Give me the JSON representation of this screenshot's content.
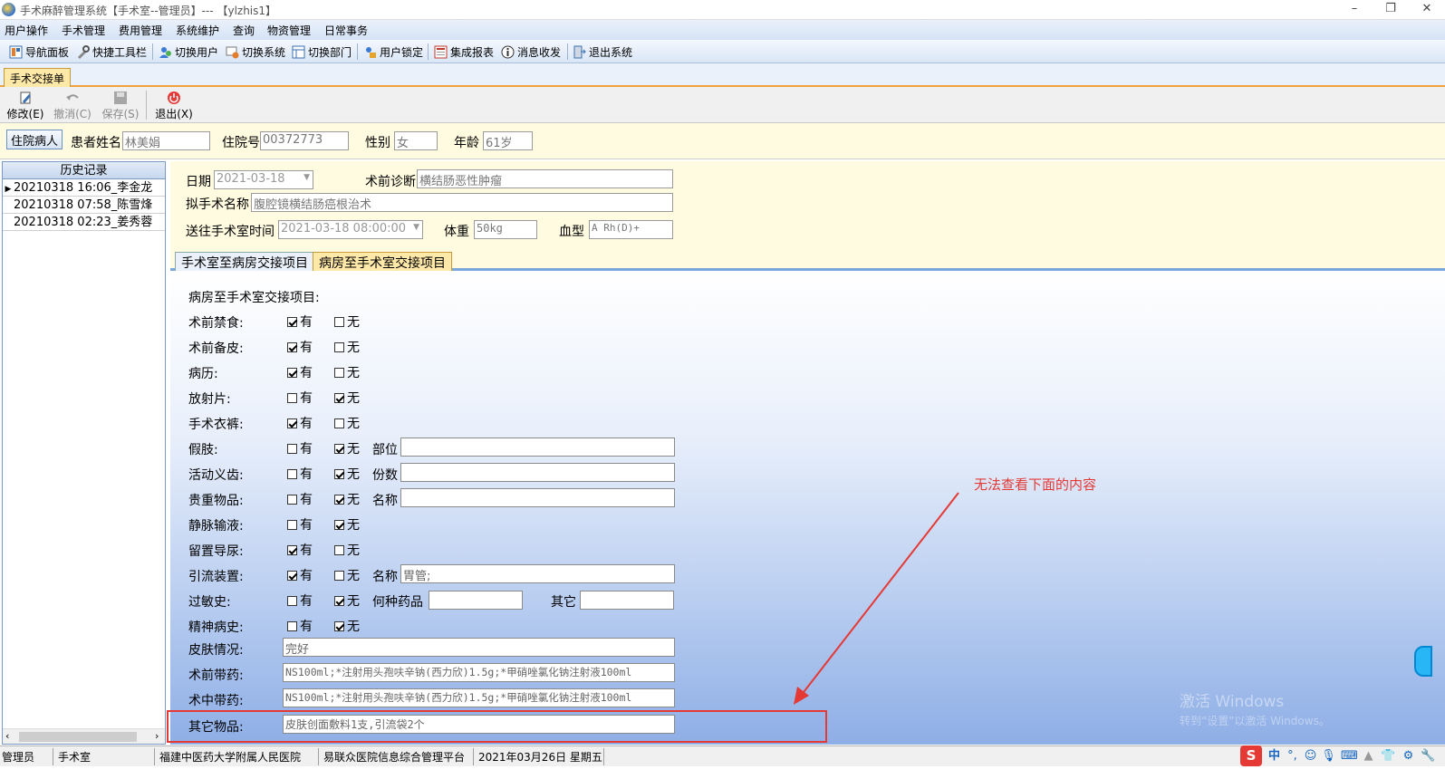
{
  "window": {
    "title": "手术麻醉管理系统【手术室--管理员】--- 【ylzhis1】"
  },
  "menu": [
    "用户操作",
    "手术管理",
    "费用管理",
    "系统维护",
    "查询",
    "物资管理",
    "日常事务"
  ],
  "toolbar": [
    "导航面板",
    "快捷工具栏",
    "切换用户",
    "切换系统",
    "切换部门",
    "用户锁定",
    "集成报表",
    "消息收发",
    "退出系统"
  ],
  "doc_tab": "手术交接单",
  "actions": {
    "edit": "修改(E)",
    "undo": "撤消(C)",
    "save": "保存(S)",
    "exit": "退出(X)"
  },
  "patient": {
    "button": "住院病人",
    "name_label": "患者姓名",
    "name": "林美娟",
    "admission_label": "住院号",
    "admission": "00372773",
    "sex_label": "性别",
    "sex": "女",
    "age_label": "年龄",
    "age": "61岁"
  },
  "history": {
    "title": "历史记录",
    "rows": [
      "20210318 16:06_李金龙",
      "20210318 07:58_陈雪烽",
      "20210318 02:23_姜秀蓉"
    ]
  },
  "form": {
    "date_label": "日期",
    "date": "2021-03-18",
    "diagnosis_label": "术前诊断",
    "diagnosis": "横结肠恶性肿瘤",
    "surgery_label": "拟手术名称",
    "surgery": "腹腔镜横结肠癌根治术",
    "sendtime_label": "送往手术室时间",
    "sendtime": "2021-03-18 08:00:00",
    "weight_label": "体重",
    "weight": "50kg",
    "blood_label": "血型",
    "blood": "A Rh(D)+"
  },
  "subtabs": [
    "手术室至病房交接项目",
    "病房至手术室交接项目"
  ],
  "handover": {
    "section_title": "病房至手术室交接项目:",
    "yes": "有",
    "no": "无",
    "items": [
      {
        "label": "术前禁食:",
        "yes": true
      },
      {
        "label": "术前备皮:",
        "yes": true
      },
      {
        "label": "病历:",
        "yes": true
      },
      {
        "label": "放射片:",
        "yes": false
      },
      {
        "label": "手术衣裤:",
        "yes": true
      },
      {
        "label": "假肢:",
        "yes": false,
        "extra_label": "部位",
        "extra_value": ""
      },
      {
        "label": "活动义齿:",
        "yes": false,
        "extra_label": "份数",
        "extra_value": ""
      },
      {
        "label": "贵重物品:",
        "yes": false,
        "extra_label": "名称",
        "extra_value": ""
      },
      {
        "label": "静脉输液:",
        "yes": false
      },
      {
        "label": "留置导尿:",
        "yes": true
      },
      {
        "label": "引流装置:",
        "yes": true,
        "extra_label": "名称",
        "extra_value": "胃管;"
      },
      {
        "label": "过敏史:",
        "yes": false
      },
      {
        "label": "精神病史:",
        "yes": false
      }
    ],
    "allergy_drug_label": "何种药品",
    "allergy_other_label": "其它",
    "skin_label": "皮肤情况:",
    "skin": "完好",
    "preop_drug_label": "术前带药:",
    "preop_drug": "NS100ml;*注射用头孢呋辛钠(西力欣)1.5g;*甲硝唑氯化钠注射液100ml",
    "intraop_drug_label": "术中带药:",
    "intraop_drug": "NS100ml;*注射用头孢呋辛钠(西力欣)1.5g;*甲硝唑氯化钠注射液100ml",
    "other_label": "其它物品:",
    "other": "皮肤创面敷料1支,引流袋2个"
  },
  "annotation": {
    "text": "无法查看下面的内容",
    "color": "#e53935"
  },
  "watermark": {
    "line1": "激活 Windows",
    "line2": "转到“设置”以激活 Windows。"
  },
  "status": [
    "管理员",
    "手术室",
    "福建中医药大学附属人民医院",
    "易联众医院信息综合管理平台",
    "2021年03月26日 星期五"
  ],
  "tray": {
    "ime": "中"
  },
  "colors": {
    "accent_tab": "#ffe9a8",
    "form_bg": "#fffbe0",
    "annotation": "#e53935"
  }
}
